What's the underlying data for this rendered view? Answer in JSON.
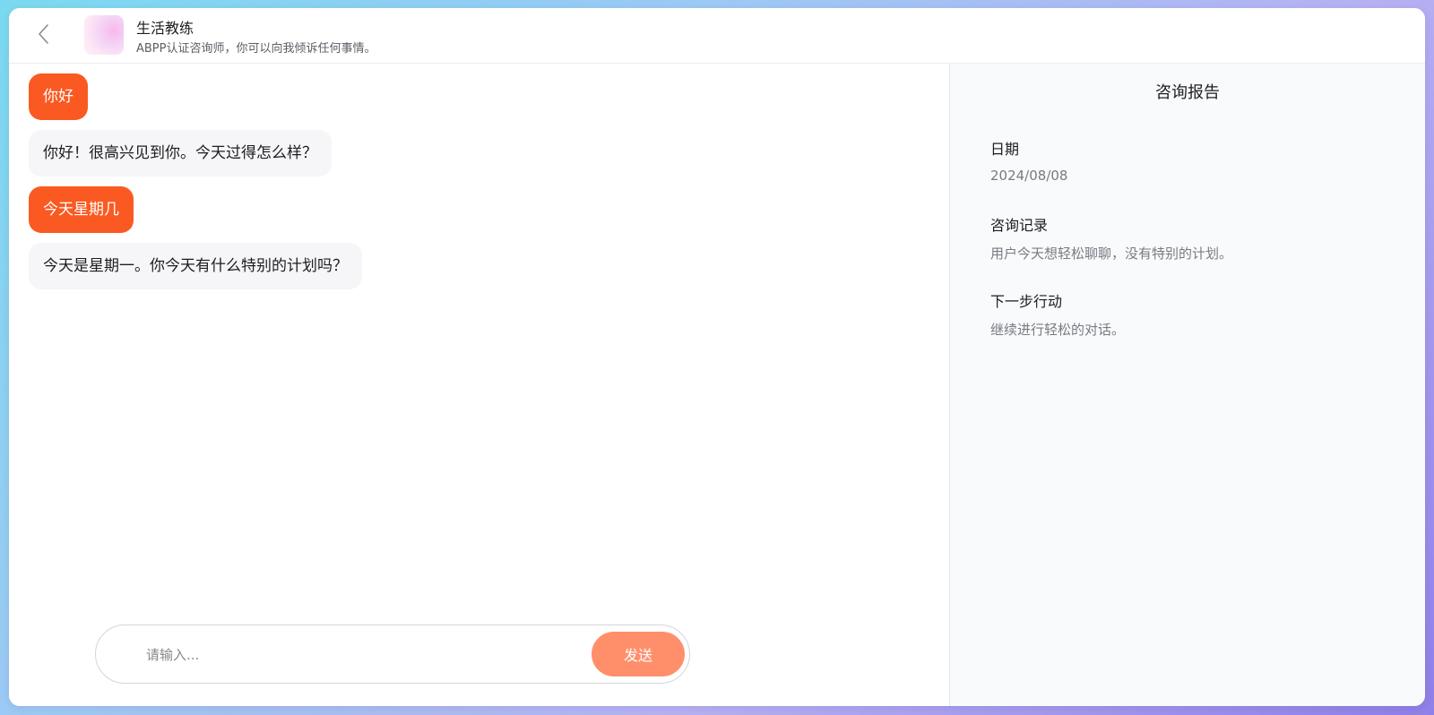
{
  "header": {
    "back_icon": "chevron-left-icon",
    "title": "生活教练",
    "subtitle": "ABPP认证咨询师，你可以向我倾诉任何事情。"
  },
  "chat": {
    "messages": [
      {
        "role": "user",
        "text": "你好"
      },
      {
        "role": "assistant",
        "text": "你好！很高兴见到你。今天过得怎么样？"
      },
      {
        "role": "user",
        "text": "今天星期几"
      },
      {
        "role": "assistant",
        "text": "今天是星期一。你今天有什么特别的计划吗？"
      }
    ]
  },
  "composer": {
    "placeholder": "请输入...",
    "value": "",
    "send_label": "发送"
  },
  "report": {
    "title": "咨询报告",
    "sections": [
      {
        "label": "日期",
        "value": "2024/08/08"
      },
      {
        "label": "咨询记录",
        "value": "用户今天想轻松聊聊，没有特别的计划。"
      },
      {
        "label": "下一步行动",
        "value": "继续进行轻松的对话。"
      }
    ]
  },
  "colors": {
    "user_bubble": "#fa5a22",
    "assistant_bubble": "#f6f6f8",
    "send_button": "#ff8f6b",
    "report_bg": "#f9fafc"
  }
}
